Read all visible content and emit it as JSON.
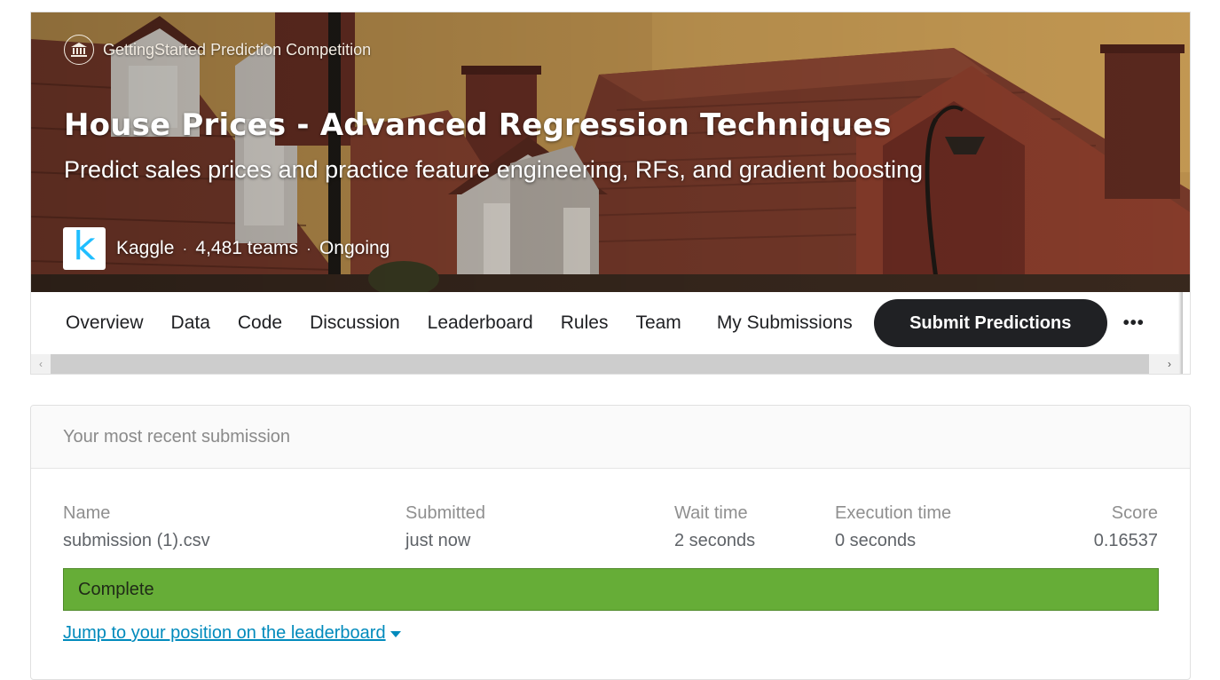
{
  "competition": {
    "type_label": "GettingStarted Prediction Competition",
    "title": "House Prices - Advanced Regression Techniques",
    "subtitle": "Predict sales prices and practice feature engineering, RFs, and gradient boosting",
    "host_logo_letter": "k",
    "host": "Kaggle",
    "teams": "4,481 teams",
    "status": "Ongoing",
    "separator": "·"
  },
  "tabs": [
    {
      "label": "Overview"
    },
    {
      "label": "Data"
    },
    {
      "label": "Code"
    },
    {
      "label": "Discussion"
    },
    {
      "label": "Leaderboard"
    },
    {
      "label": "Rules"
    },
    {
      "label": "Team"
    },
    {
      "label": "My Submissions"
    }
  ],
  "actions": {
    "submit_label": "Submit Predictions",
    "more_label": "•••"
  },
  "scrollbar": {
    "left_arrow": "‹",
    "right_arrow": "›"
  },
  "submission": {
    "heading": "Your most recent submission",
    "columns": {
      "name": "Name",
      "submitted": "Submitted",
      "wait_time": "Wait time",
      "execution_time": "Execution time",
      "score": "Score"
    },
    "values": {
      "name": "submission (1).csv",
      "submitted": "just now",
      "wait_time": "2 seconds",
      "execution_time": "0 seconds",
      "score": "0.16537"
    },
    "status": "Complete",
    "jump_link": "Jump to your position on the leaderboard"
  },
  "colors": {
    "host_logo_accent": "#20beff",
    "submit_button_bg": "#202124",
    "status_complete_bg": "#66ad37",
    "link": "#008abc"
  },
  "icons": {
    "competition_type": "bank-icon",
    "dropdown": "caret-down-icon"
  }
}
